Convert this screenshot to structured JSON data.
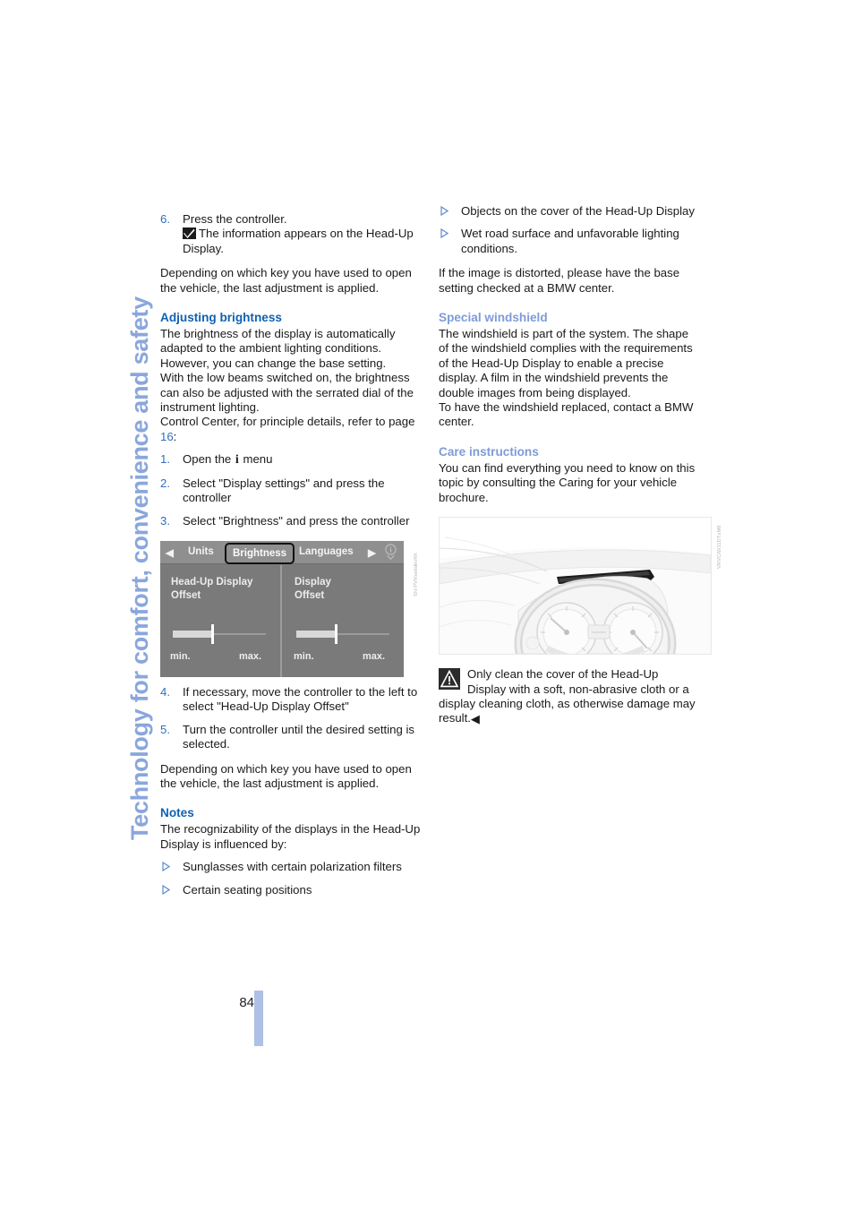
{
  "chapter": {
    "vertical_title": "Technology for comfort, convenience and safety"
  },
  "page": {
    "number": "84"
  },
  "left_column": {
    "step6": {
      "num": "6.",
      "line1": "Press the controller.",
      "check_icon": "checkmark-icon",
      "line2": "The information appears on the Head-Up Display."
    },
    "para_depending_1": "Depending on which key you have used to open the vehicle, the last adjustment is applied.",
    "heading_adjusting_brightness": "Adjusting brightness",
    "para_brightness_1": "The brightness of the display is automatically adapted to the ambient lighting conditions. However, you can change the base setting.",
    "para_brightness_2": "With the low beams switched on, the brightness can also be adjusted with the serrated dial of the instrument lighting.",
    "para_control_center_a": "Control Center, for principle details, refer to page ",
    "para_control_center_page": "16",
    "para_control_center_b": ":",
    "steps": [
      {
        "num": "1.",
        "text_before": "Open the ",
        "icon": "info-i-icon",
        "text_after": " menu"
      },
      {
        "num": "2.",
        "text": "Select \"Display settings\" and press the controller"
      },
      {
        "num": "3.",
        "text": "Select \"Brightness\" and press the controller"
      },
      {
        "num": "4.",
        "text": "If necessary, move the controller to the left to select \"Head-Up Display Offset\""
      },
      {
        "num": "5.",
        "text": "Turn the controller until the desired setting is selected."
      }
    ],
    "para_depending_2": "Depending on which key you have used to open the vehicle, the last adjustment is applied.",
    "heading_notes": "Notes",
    "para_notes": "The recognizability of the displays in the Head-Up Display is influenced by:",
    "notes_bullets": [
      "Sunglasses with certain polarization filters",
      "Certain seating positions"
    ]
  },
  "idrive_figure": {
    "topbar": {
      "arrow_left": "◀",
      "arrow_right": "▶",
      "units": "Units",
      "brightness": "Brightness",
      "languages": "Languages",
      "info": "i"
    },
    "left_pane": {
      "title": "Head-Up Display\nOffset",
      "min": "min.",
      "max": "max.",
      "value_percent": 41
    },
    "right_pane": {
      "title": "Display\nOffset",
      "min": "min.",
      "max": "max.",
      "value_percent": 41
    },
    "figure_code": "SN-PVRsebdkvRh"
  },
  "right_column": {
    "bullets_top": [
      "Objects on the cover of the Head-Up Display",
      "Wet road surface and unfavorable lighting conditions."
    ],
    "para_distorted": "If the image is distorted, please have the base setting checked at a BMW center.",
    "heading_special_windshield": "Special windshield",
    "para_windshield_1": "The windshield is part of the system. The shape of the windshield complies with the requirements of the Head-Up Display to enable a precise display. A film in the windshield prevents the double images from being displayed.",
    "para_windshield_2": "To have the windshield replaced, contact a BMW center.",
    "heading_care_instructions": "Care instructions",
    "para_care": "You can find everything you need to know on this topic by consulting the Caring for your vehicle brochure.",
    "dashboard_figure_code": "VRVCIW11DTxM6",
    "warning": {
      "icon": "warning-triangle-icon",
      "text": "Only clean the cover of the Head-Up Display with a soft, non-abrasive cloth or a display cleaning cloth, as otherwise damage may result.",
      "end_marker": "◀"
    }
  },
  "colors": {
    "heading_blue_strong": "#0f62b0",
    "heading_blue_light": "#7e9bd8",
    "chapter_title_blue": "#8aa7dc",
    "page_bar_blue": "#aec0e6",
    "bullet_blue": "#5c8ccc"
  }
}
